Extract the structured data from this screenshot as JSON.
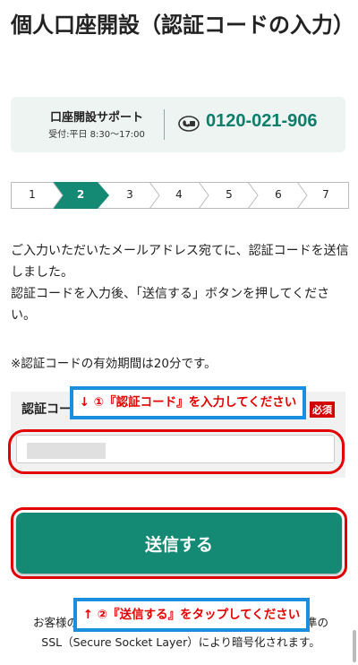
{
  "page": {
    "title": "個人口座開設（認証コードの入力）"
  },
  "support": {
    "name": "口座開設サポート",
    "hours": "受付:平日 8:30〜17:00",
    "phone": "0120-021-906",
    "icon": "freedial-icon"
  },
  "steps": {
    "items": [
      "1",
      "2",
      "3",
      "4",
      "5",
      "6",
      "7"
    ],
    "current": 2,
    "colors": {
      "active": "#148a74",
      "inactive": "#ffffff",
      "border": "#bbbbbb"
    }
  },
  "body": {
    "line1": "ご入力いただいたメールアドレス宛てに、認証コードを送信しました。",
    "line2": "認証コードを入力後、「送信する」ボタンを押してください。",
    "note": "※認証コードの有効期間は20分です。"
  },
  "form": {
    "label": "認証コード",
    "required": "必須",
    "value": "",
    "placeholder": ""
  },
  "annotations": {
    "callout1": "↓ ①『認証コード』を入力してください",
    "callout2": "↑ ②『送信する』をタップしてください"
  },
  "submit": {
    "label": "送信する"
  },
  "footer": {
    "line1_left": "お客様のご",
    "line1_right": "標準の",
    "line2": "SSL（Secure Socket Layer）により暗号化されます。"
  },
  "colors": {
    "brand": "#148a74",
    "highlight": "#e30000",
    "callout_border": "#1a8fe0"
  }
}
